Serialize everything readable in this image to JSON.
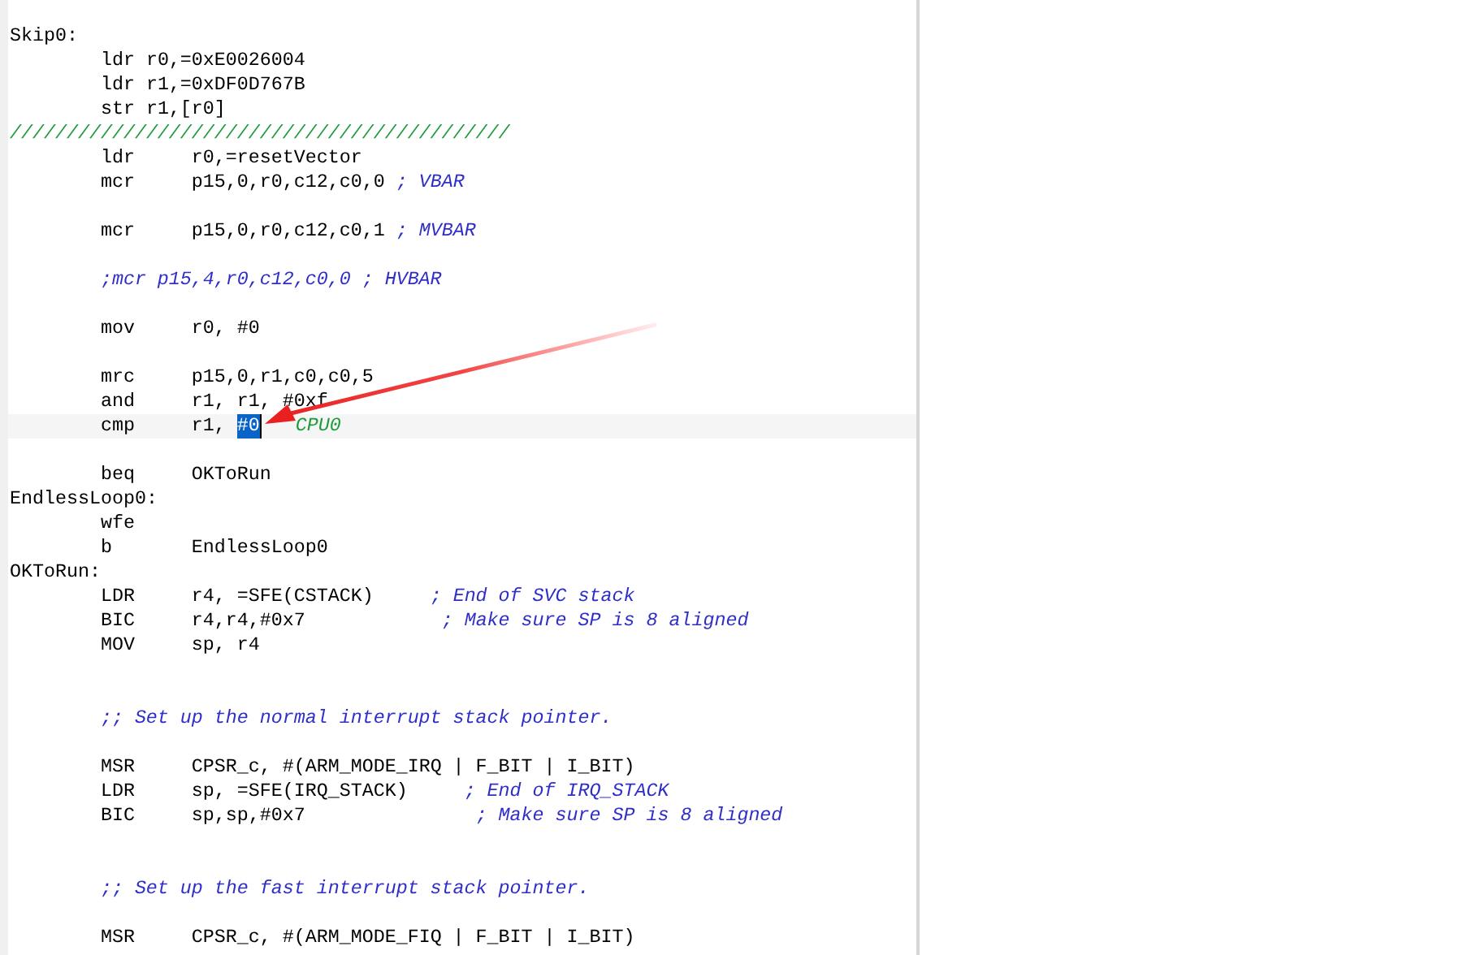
{
  "lines": [
    {
      "kind": "label",
      "text": "Skip0:"
    },
    {
      "kind": "code",
      "code": "\tldr r0,=0xE0026004"
    },
    {
      "kind": "code",
      "code": "\tldr r1,=0xDF0D767B"
    },
    {
      "kind": "code",
      "code": "\tstr r1,[r0]"
    },
    {
      "kind": "divider",
      "text": "////////////////////////////////////////////"
    },
    {
      "kind": "code",
      "code": "\tldr     r0,=resetVector"
    },
    {
      "kind": "code",
      "code": "\tmcr     p15,0,r0,c12,c0,0 ",
      "comment": {
        "kind": "semicolon",
        "text": "; VBAR"
      }
    },
    {
      "kind": "blank"
    },
    {
      "kind": "code",
      "code": "\tmcr     p15,0,r0,c12,c0,1 ",
      "comment": {
        "kind": "semicolon",
        "text": "; MVBAR"
      }
    },
    {
      "kind": "blank"
    },
    {
      "kind": "comment",
      "comment": {
        "kind": "semicolon",
        "text": ";mcr p15,4,r0,c12,c0,0 ; HVBAR"
      }
    },
    {
      "kind": "blank"
    },
    {
      "kind": "code",
      "code": "\tmov     r0, #0"
    },
    {
      "kind": "blank"
    },
    {
      "kind": "code",
      "code": "\tmrc     p15,0,r1,c0,c0,5"
    },
    {
      "kind": "code",
      "code": "\tand     r1, r1, #0xf"
    },
    {
      "kind": "current_code",
      "code": "\tcmp     r1, ",
      "selected_text": "#0",
      "comment": {
        "kind": "slash",
        "text": "CPU0"
      }
    },
    {
      "kind": "blank"
    },
    {
      "kind": "code",
      "code": "\tbeq     OKToRun"
    },
    {
      "kind": "label",
      "text": "EndlessLoop0:"
    },
    {
      "kind": "code",
      "code": "\twfe"
    },
    {
      "kind": "code",
      "code": "\tb       EndlessLoop0"
    },
    {
      "kind": "label",
      "text": "OKToRun:"
    },
    {
      "kind": "code",
      "code": "\tLDR     r4, =SFE(CSTACK)     ",
      "comment": {
        "kind": "semicolon",
        "text": "; End of SVC stack"
      }
    },
    {
      "kind": "code",
      "code": "\tBIC     r4,r4,#0x7            ",
      "comment": {
        "kind": "semicolon",
        "text": "; Make sure SP is 8 aligned"
      }
    },
    {
      "kind": "code",
      "code": "\tMOV     sp, r4"
    },
    {
      "kind": "blank"
    },
    {
      "kind": "blank"
    },
    {
      "kind": "comment",
      "comment": {
        "kind": "semicolon",
        "text": ";; Set up the normal interrupt stack pointer."
      }
    },
    {
      "kind": "blank"
    },
    {
      "kind": "code",
      "code": "\tMSR     CPSR_c, #(ARM_MODE_IRQ | F_BIT | I_BIT)"
    },
    {
      "kind": "code",
      "code": "\tLDR     sp, =SFE(IRQ_STACK)     ",
      "comment": {
        "kind": "semicolon",
        "text": "; End of IRQ_STACK"
      }
    },
    {
      "kind": "code",
      "code": "\tBIC     sp,sp,#0x7               ",
      "comment": {
        "kind": "semicolon",
        "text": "; Make sure SP is 8 aligned"
      }
    },
    {
      "kind": "blank"
    },
    {
      "kind": "blank"
    },
    {
      "kind": "comment",
      "comment": {
        "kind": "semicolon",
        "text": ";; Set up the fast interrupt stack pointer."
      }
    },
    {
      "kind": "blank"
    },
    {
      "kind": "code",
      "code": "\tMSR     CPSR_c, #(ARM_MODE_FIQ | F_BIT | I_BIT)"
    }
  ]
}
